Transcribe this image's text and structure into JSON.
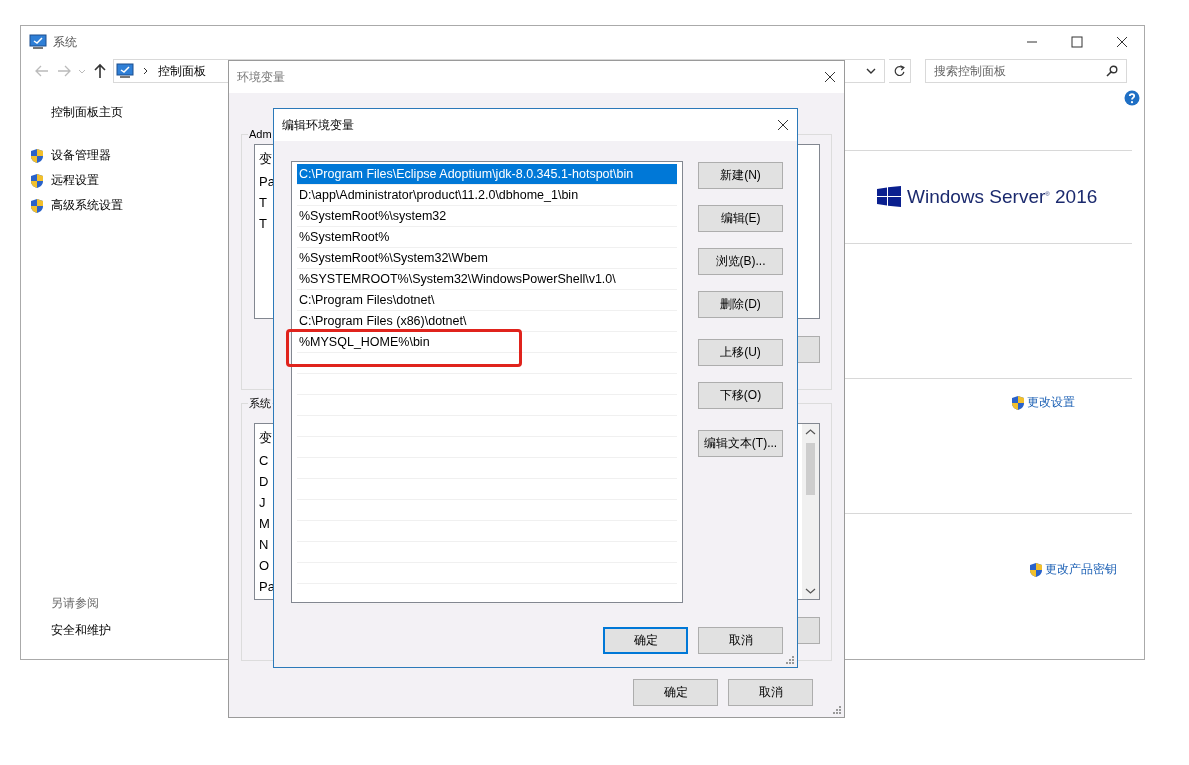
{
  "system_window": {
    "title": "系统",
    "breadcrumb": "控制面板",
    "search": {
      "placeholder": "搜索控制面板"
    },
    "sidebar": {
      "home": "控制面板主页",
      "items": [
        {
          "label": "设备管理器"
        },
        {
          "label": "远程设置"
        },
        {
          "label": "高级系统设置"
        }
      ]
    },
    "see_also": {
      "heading": "另请参阅",
      "links": [
        "安全和维护"
      ]
    },
    "edition": "Windows Server$^{®}$ 2016",
    "links": [
      {
        "label": "更改设置"
      },
      {
        "label": "更改产品密钥"
      }
    ]
  },
  "env_window": {
    "title": "环境变量",
    "user_group": {
      "label": "Adm",
      "header": "变",
      "rows": [
        "Pa",
        "T",
        "T"
      ]
    },
    "system_group": {
      "label": "系统",
      "header": "变",
      "rows": [
        "C",
        "D",
        "J",
        "M",
        "N",
        "O",
        "Pa"
      ]
    },
    "buttons": [
      "确定",
      "取消"
    ]
  },
  "edit_dialog": {
    "title": "编辑环境变量",
    "entries": [
      {
        "text": "C:\\Program Files\\Eclipse Adoptium\\jdk-8.0.345.1-hotspot\\bin",
        "selected": true,
        "highlighted": false
      },
      {
        "text": "D:\\app\\Administrator\\product\\11.2.0\\dbhome_1\\bin",
        "selected": false,
        "highlighted": false
      },
      {
        "text": "%SystemRoot%\\system32",
        "selected": false,
        "highlighted": false
      },
      {
        "text": "%SystemRoot%",
        "selected": false,
        "highlighted": false
      },
      {
        "text": "%SystemRoot%\\System32\\Wbem",
        "selected": false,
        "highlighted": false
      },
      {
        "text": "%SYSTEMROOT%\\System32\\WindowsPowerShell\\v1.0\\",
        "selected": false,
        "highlighted": false
      },
      {
        "text": "C:\\Program Files\\dotnet\\",
        "selected": false,
        "highlighted": false
      },
      {
        "text": "C:\\Program Files (x86)\\dotnet\\",
        "selected": false,
        "highlighted": false
      },
      {
        "text": "%MYSQL_HOME%\\bin",
        "selected": false,
        "highlighted": true
      }
    ],
    "side_buttons": [
      [
        "新建(N)",
        "编辑(E)",
        "浏览(B)...",
        "删除(D)"
      ],
      [
        "上移(U)",
        "下移(O)"
      ],
      [
        "编辑文本(T)..."
      ]
    ],
    "buttons": [
      {
        "label": "确定",
        "default": true
      },
      {
        "label": "取消",
        "default": false
      }
    ]
  }
}
